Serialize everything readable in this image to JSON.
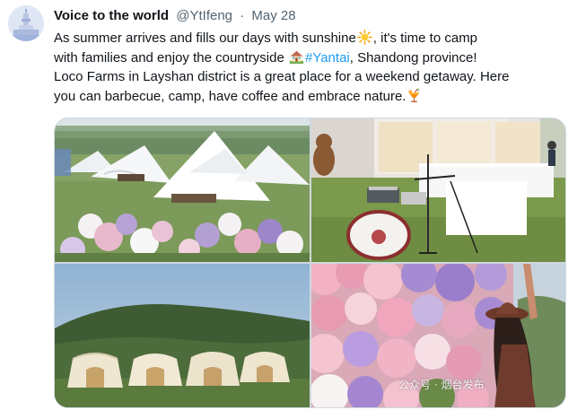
{
  "tweet": {
    "display_name": "Voice to the world",
    "handle": "@YtIfeng",
    "separator": "·",
    "date": "May 28",
    "avatar_icon": "avatar-logo",
    "text": {
      "line1_a": "As summer arrives and fills our days with sunshine",
      "line1_b": ", it's time to camp",
      "line2_a": "with families and enjoy the countryside ",
      "line2_hashtag": "#Yantai",
      "line2_b": ", Shandong province!",
      "line3": "Loco Farms in Layshan district is a great place for a weekend getaway. Here",
      "line4": "you can barbecue, camp, have coffee and embrace nature."
    },
    "emojis": [
      "sun-emoji",
      "house-emoji",
      "tropical-drink-emoji"
    ],
    "hashtag_color": "#1d9bf0"
  },
  "media": {
    "photos": [
      {
        "subject": "white tents flower field"
      },
      {
        "subject": "drum set cafe lawn"
      },
      {
        "subject": "bell tents hillside"
      },
      {
        "subject": "flower wall woman hat"
      }
    ],
    "watermark": "公众号 · 烟台发布"
  }
}
